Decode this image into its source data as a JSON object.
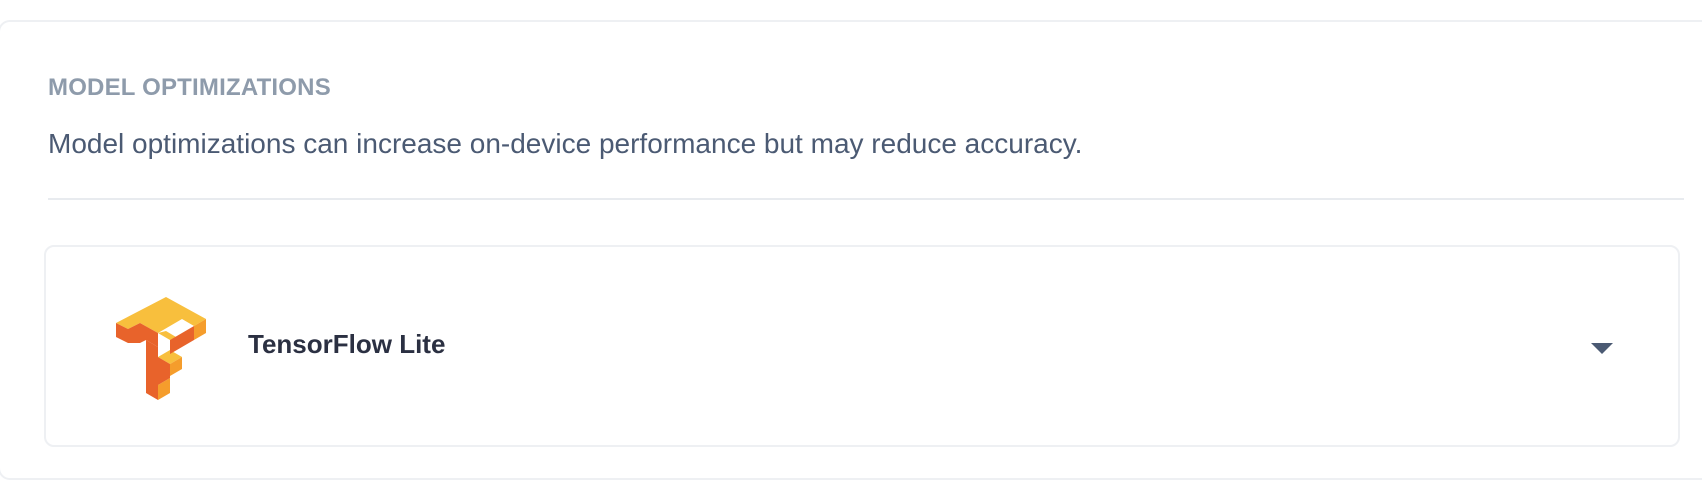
{
  "section": {
    "title": "MODEL OPTIMIZATIONS",
    "description": "Model optimizations can increase on-device performance but may reduce accuracy."
  },
  "engine": {
    "name": "TensorFlow Lite",
    "logo_icon": "tensorflow-logo-icon",
    "expand_icon": "chevron-down-icon",
    "expanded": false
  },
  "colors": {
    "title": "#8e9bab",
    "description": "#4b5a73",
    "engine_name": "#2b3042",
    "chevron": "#4b5a73",
    "logo_top": "#f8bf3d",
    "logo_side_light": "#f59d2c",
    "logo_side_dark": "#e8632b"
  }
}
